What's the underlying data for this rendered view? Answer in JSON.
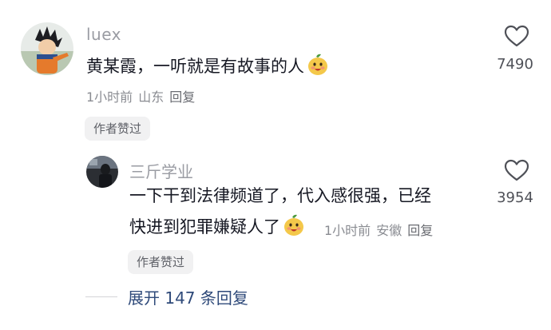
{
  "comment": {
    "username": "luex",
    "text": "黄某霞，一听就是有故事的人",
    "time": "1小时前",
    "location": "山东",
    "reply_label": "回复",
    "author_badge": "作者赞过",
    "like_count": "7490",
    "like_icon": "heart-outline-icon",
    "emoji_icon": "smiling-mango-emoji-icon",
    "avatar_icon": "anime-character-avatar"
  },
  "reply": {
    "username": "三斤学业",
    "text_line1": "一下干到法律频道了，代入感很强，已经",
    "text_line2": "快进到犯罪嫌疑人了",
    "time": "1小时前",
    "location": "安徽",
    "reply_label": "回复",
    "author_badge": "作者赞过",
    "like_count": "3954",
    "like_icon": "heart-outline-icon",
    "emoji_icon": "smiling-mango-emoji-icon",
    "avatar_icon": "dark-photo-avatar"
  },
  "expand": {
    "label": "展开 147 条回复"
  },
  "colors": {
    "username": "#9a9ca3",
    "text": "#161823",
    "meta": "#8a8c92",
    "badge_bg": "#f1f1f2",
    "expand_link": "#2f4a7a"
  }
}
